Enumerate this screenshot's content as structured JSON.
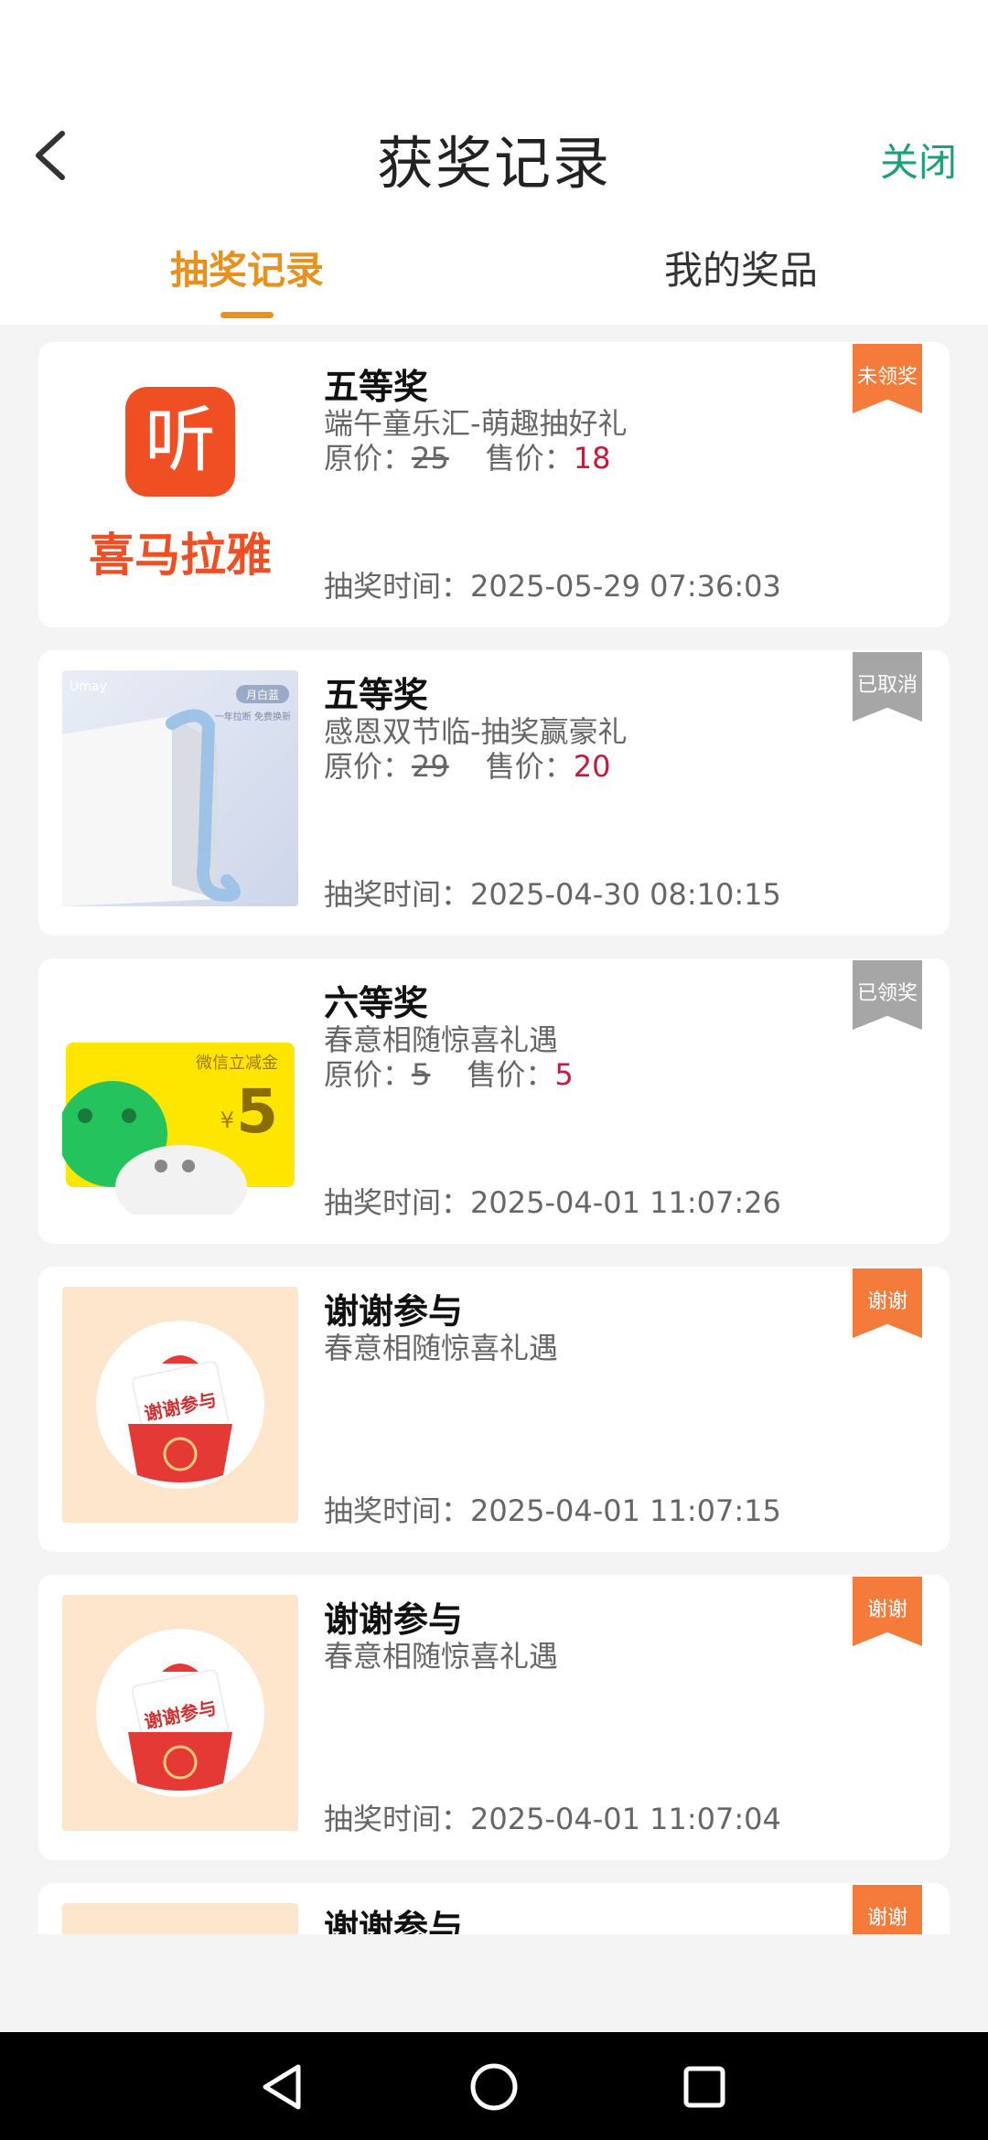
{
  "header": {
    "title": "获奖记录",
    "close_label": "关闭",
    "tabs": [
      {
        "label": "抽奖记录",
        "active": true
      },
      {
        "label": "我的奖品",
        "active": false
      }
    ]
  },
  "colors": {
    "accent": "#e8911c",
    "close_green": "#1aa17a",
    "sale_price": "#c41a3c",
    "ribbon_orange": "#f47b3a",
    "ribbon_gray": "#a6a6a6"
  },
  "records": [
    {
      "prize": "五等奖",
      "event": "端午童乐汇-萌趣抽好礼",
      "orig_label": "原价：",
      "orig_price": "25",
      "sale_label": "售价：",
      "sale_price": "18",
      "time_label": "抽奖时间：",
      "time": "2025-05-29 07:36:03",
      "status": "未领奖",
      "thumb_text": "喜马拉雅",
      "thumb_icon": "听"
    },
    {
      "prize": "五等奖",
      "event": "感恩双节临-抽奖赢豪礼",
      "orig_label": "原价：",
      "orig_price": "29",
      "sale_label": "售价：",
      "sale_price": "20",
      "time_label": "抽奖时间：",
      "time": "2025-04-30 08:10:15",
      "status": "已取消",
      "thumb_brand": "Umay",
      "thumb_tag": "月白蓝",
      "thumb_sub": "一年拉断 免费换新"
    },
    {
      "prize": "六等奖",
      "event": "春意相随惊喜礼遇",
      "orig_label": "原价：",
      "orig_price": "5",
      "sale_label": "售价：",
      "sale_price": "5",
      "time_label": "抽奖时间：",
      "time": "2025-04-01 11:07:26",
      "status": "已领奖",
      "thumb_text": "微信立减金",
      "thumb_currency": "¥",
      "thumb_amount": "5"
    },
    {
      "prize": "谢谢参与",
      "event": "春意相随惊喜礼遇",
      "time_label": "抽奖时间：",
      "time": "2025-04-01 11:07:15",
      "status": "谢谢",
      "thumb_text": "谢谢参与"
    },
    {
      "prize": "谢谢参与",
      "event": "春意相随惊喜礼遇",
      "time_label": "抽奖时间：",
      "time": "2025-04-01 11:07:04",
      "status": "谢谢",
      "thumb_text": "谢谢参与"
    },
    {
      "prize": "谢谢参与",
      "status": "谢谢"
    }
  ],
  "icons": {
    "back": "back-arrow-icon",
    "nav_back": "triangle-back-icon",
    "nav_home": "circle-home-icon",
    "nav_recents": "square-recents-icon"
  }
}
